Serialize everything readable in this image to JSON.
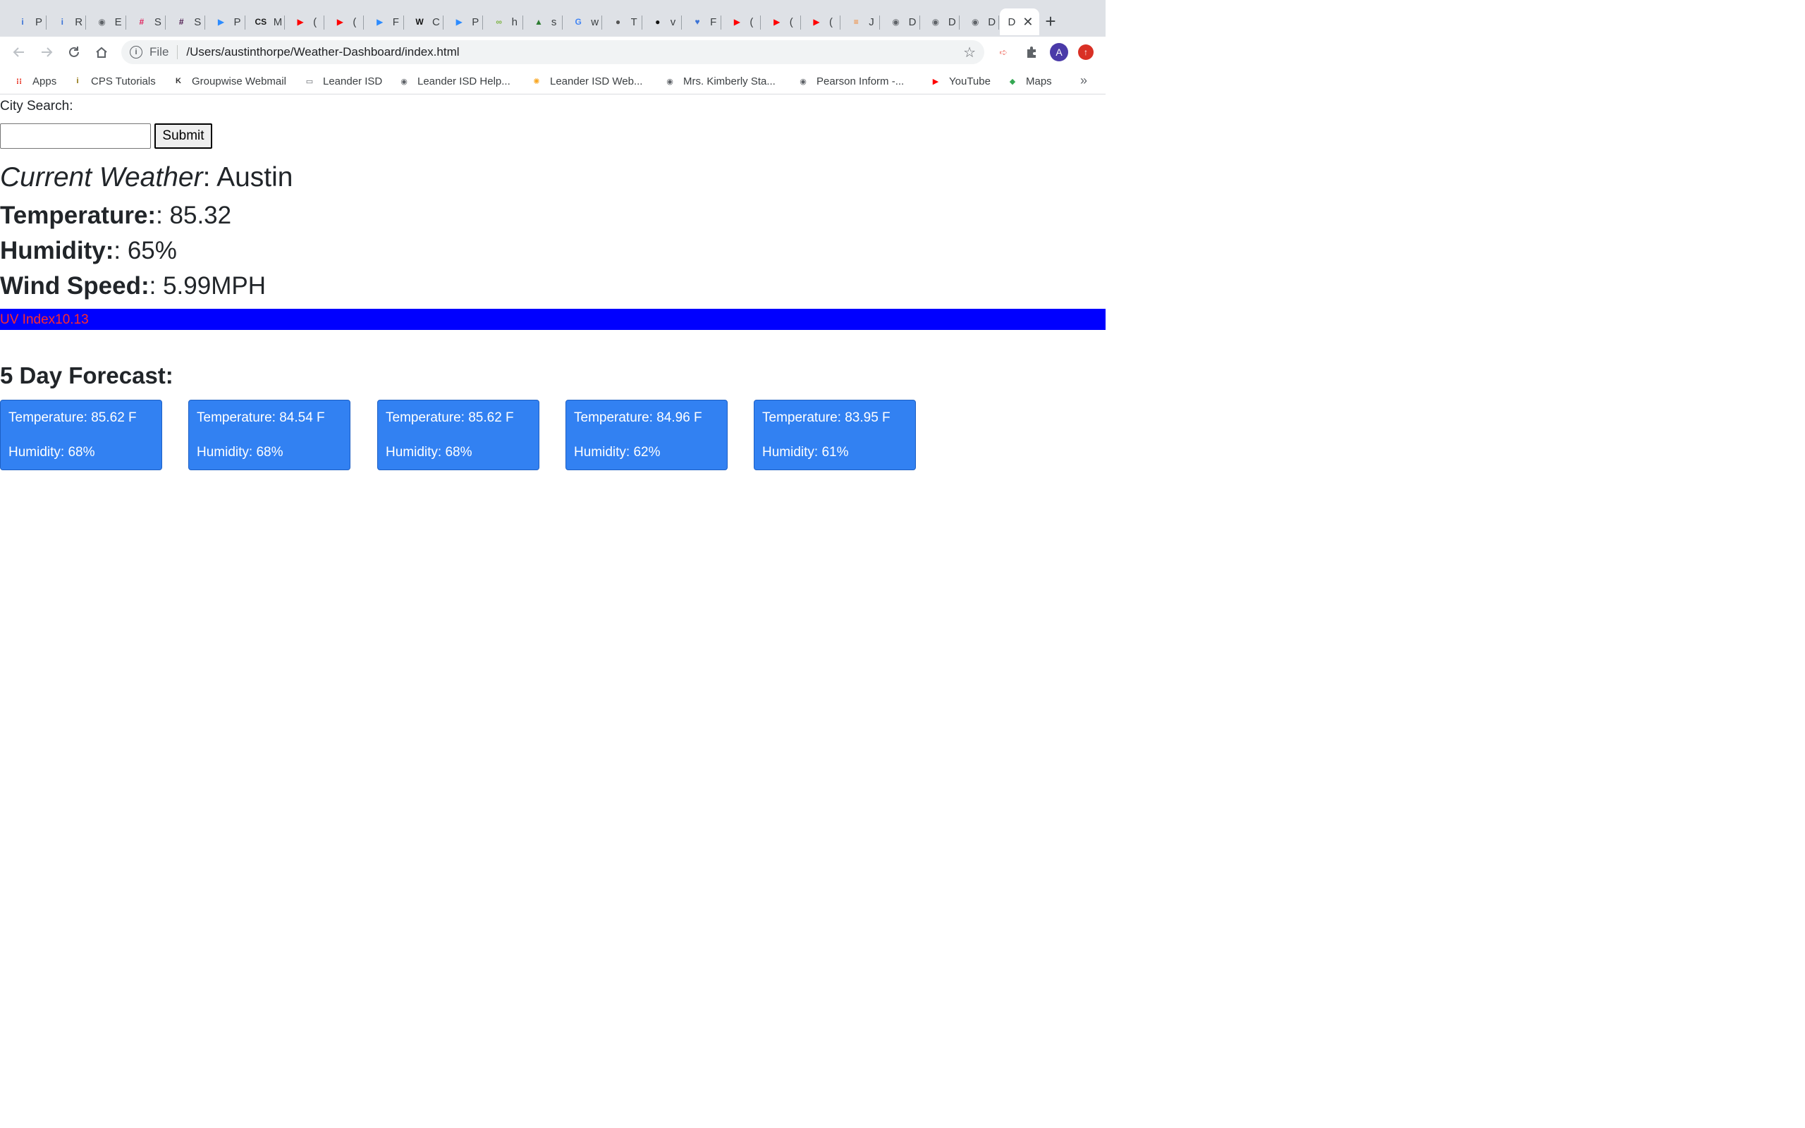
{
  "browser": {
    "tabs": [
      {
        "letter": "P",
        "icon": "info-icon",
        "color": "#3b73d6"
      },
      {
        "letter": "R",
        "icon": "info-icon",
        "color": "#3b73d6"
      },
      {
        "letter": "E",
        "icon": "globe-icon",
        "color": "#5f6368"
      },
      {
        "letter": "S",
        "icon": "slack-icon",
        "color": "#e01e5a"
      },
      {
        "letter": "S",
        "icon": "slack-icon",
        "color": "#4a154b"
      },
      {
        "letter": "P",
        "icon": "zoom-icon",
        "color": "#2d8cff"
      },
      {
        "letter": "M",
        "icon": "cs-icon",
        "color": "#1a1a1a"
      },
      {
        "letter": "(",
        "icon": "youtube-icon",
        "color": "#ff0000"
      },
      {
        "letter": "(",
        "icon": "youtube-icon",
        "color": "#ff0000"
      },
      {
        "letter": "F",
        "icon": "zoom-icon",
        "color": "#2d8cff"
      },
      {
        "letter": "C",
        "icon": "w-icon",
        "color": "#111111"
      },
      {
        "letter": "P",
        "icon": "zoom-icon",
        "color": "#2d8cff"
      },
      {
        "letter": "h",
        "icon": "link-icon",
        "color": "#7cb342"
      },
      {
        "letter": "s",
        "icon": "shark-icon",
        "color": "#2e7d32"
      },
      {
        "letter": "w",
        "icon": "google-icon",
        "color": "#4285f4"
      },
      {
        "letter": "T",
        "icon": "apple-icon",
        "color": "#555555"
      },
      {
        "letter": "v",
        "icon": "github-icon",
        "color": "#111111"
      },
      {
        "letter": "F",
        "icon": "heart-icon",
        "color": "#3b73d6"
      },
      {
        "letter": "(",
        "icon": "youtube-icon",
        "color": "#ff0000"
      },
      {
        "letter": "(",
        "icon": "youtube-icon",
        "color": "#ff0000"
      },
      {
        "letter": "(",
        "icon": "youtube-icon",
        "color": "#ff0000"
      },
      {
        "letter": "J",
        "icon": "stackoverflow-icon",
        "color": "#f48024"
      },
      {
        "letter": "D",
        "icon": "globe-icon",
        "color": "#5f6368"
      },
      {
        "letter": "D",
        "icon": "globe-icon",
        "color": "#5f6368"
      },
      {
        "letter": "D",
        "icon": "globe-icon",
        "color": "#5f6368"
      }
    ],
    "active_tab": {
      "letter": "D"
    },
    "address": {
      "scheme": "File",
      "path": "/Users/austinthorpe/Weather-Dashboard/index.html"
    },
    "profile_initial": "A",
    "bookmarks": [
      {
        "label": "Apps",
        "icon": "apps-grid-icon"
      },
      {
        "label": "CPS Tutorials",
        "icon": "info-icon"
      },
      {
        "label": "Groupwise Webmail",
        "icon": "groupwise-icon"
      },
      {
        "label": "Leander ISD",
        "icon": "folder-icon"
      },
      {
        "label": "Leander ISD Help...",
        "icon": "globe-icon"
      },
      {
        "label": "Leander ISD Web...",
        "icon": "sun-icon"
      },
      {
        "label": "Mrs. Kimberly Sta...",
        "icon": "globe-icon"
      },
      {
        "label": "Pearson Inform -...",
        "icon": "globe-icon"
      },
      {
        "label": "YouTube",
        "icon": "youtube-icon"
      },
      {
        "label": "Maps",
        "icon": "maps-icon"
      }
    ]
  },
  "search": {
    "label": "City Search:",
    "input_value": "",
    "submit_label": "Submit"
  },
  "current": {
    "heading": "Current Weather",
    "city": ": Austin",
    "temperature_label": "Temperature:",
    "temperature_value": ": 85.32",
    "humidity_label": "Humidity:",
    "humidity_value": ": 65%",
    "wind_label": "Wind Speed:",
    "wind_value": ": 5.99MPH",
    "uv_text": "UV Index10.13",
    "uv_bar_color": "#0000ff",
    "uv_text_color": "#ff2a2a"
  },
  "forecast": {
    "title": "5 Day Forecast:",
    "card_color": "#3281f2",
    "days": [
      {
        "temp": "Temperature: 85.62 F",
        "humidity": "Humidity: 68%"
      },
      {
        "temp": "Temperature: 84.54 F",
        "humidity": "Humidity: 68%"
      },
      {
        "temp": "Temperature: 85.62 F",
        "humidity": "Humidity: 68%"
      },
      {
        "temp": "Temperature: 84.96 F",
        "humidity": "Humidity: 62%"
      },
      {
        "temp": "Temperature: 83.95 F",
        "humidity": "Humidity: 61%"
      }
    ]
  }
}
